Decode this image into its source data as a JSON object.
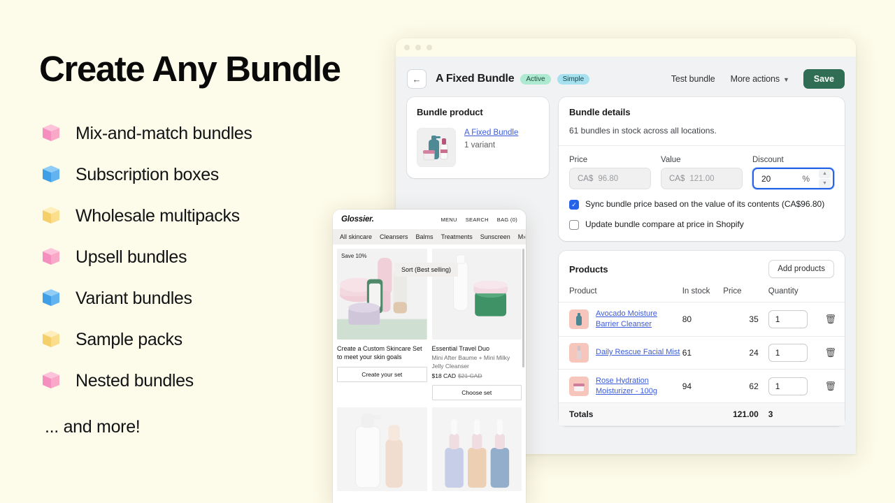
{
  "marketing": {
    "headline": "Create Any Bundle",
    "features": [
      {
        "label": "Mix-and-match bundles",
        "color": "pink"
      },
      {
        "label": "Subscription boxes",
        "color": "blue"
      },
      {
        "label": "Wholesale multipacks",
        "color": "yellow"
      },
      {
        "label": "Upsell bundles",
        "color": "pink"
      },
      {
        "label": "Variant bundles",
        "color": "blue"
      },
      {
        "label": "Sample packs",
        "color": "yellow"
      },
      {
        "label": "Nested bundles",
        "color": "pink"
      }
    ],
    "and_more": "... and more!"
  },
  "colors": {
    "page_background": "#fdfbe9",
    "admin_background": "#f1f2f4",
    "cube_pink": "#f9a8c8",
    "cube_blue": "#63b3f0",
    "cube_yellow": "#fade8e",
    "save_green": "#2f6d54",
    "badge_active": "#aee9d1",
    "badge_simple": "#a7e0ef",
    "focus_blue": "#2563eb",
    "link_blue": "#3b5bdb",
    "thumb_pink": "#f6c6bd"
  },
  "admin": {
    "topbar": {
      "back_icon": "arrow-left-icon",
      "title": "A Fixed Bundle",
      "badges": [
        {
          "label": "Active",
          "style": "active"
        },
        {
          "label": "Simple",
          "style": "simple"
        }
      ],
      "test_bundle_label": "Test bundle",
      "more_actions_label": "More actions",
      "more_actions_icon": "chevron-down-icon",
      "save_label": "Save"
    },
    "bundle_product": {
      "title": "Bundle product",
      "thumb_icon": "bundle-product-thumbnail",
      "product_link": "A Fixed Bundle",
      "variant_text": "1 variant"
    },
    "bundle_details": {
      "title": "Bundle details",
      "subtitle": "61 bundles in stock across all locations.",
      "price": {
        "label": "Price",
        "currency": "CA$",
        "value": "96.80"
      },
      "value": {
        "label": "Value",
        "currency": "CA$",
        "value": "121.00"
      },
      "discount": {
        "label": "Discount",
        "value": "20",
        "unit": "%",
        "stepper_up": "▲",
        "stepper_down": "▼"
      },
      "checkboxes": [
        {
          "label": "Sync bundle price based on the value of its contents (CA$96.80)",
          "checked": true
        },
        {
          "label": "Update bundle compare at price in Shopify",
          "checked": false
        }
      ]
    },
    "products": {
      "title": "Products",
      "add_button": "Add products",
      "columns": [
        "Product",
        "In stock",
        "Price",
        "Quantity"
      ],
      "rows": [
        {
          "name": "Avocado Moisture Barrier Cleanser",
          "in_stock": "80",
          "price": "35",
          "quantity": "1",
          "thumb": "cleanser-bottle-thumbnail",
          "delete_icon": "trash-icon"
        },
        {
          "name": "Daily Rescue Facial Mist",
          "in_stock": "61",
          "price": "24",
          "quantity": "1",
          "thumb": "mist-bottle-thumbnail",
          "delete_icon": "trash-icon"
        },
        {
          "name": "Rose Hydration Moisturizer - 100g",
          "in_stock": "94",
          "price": "62",
          "quantity": "1",
          "thumb": "moisturizer-jar-thumbnail",
          "delete_icon": "trash-icon"
        }
      ],
      "totals": {
        "label": "Totals",
        "price": "121.00",
        "quantity": "3"
      }
    }
  },
  "storefront": {
    "logo": "Glossier.",
    "nav_right": [
      "MENU",
      "SEARCH",
      "BAG (0)"
    ],
    "categories": [
      "All skincare",
      "Cleansers",
      "Balms",
      "Treatments",
      "Sunscreen"
    ],
    "categories_overflow": "M›ist",
    "sort_pill": "Sort  (Best selling)",
    "save_tag": "Save 10%",
    "tiles": [
      {
        "title": "Create a Custom Skincare Set to meet your skin goals",
        "desc": "",
        "price": "",
        "compare_at": "",
        "button": "Create your set"
      },
      {
        "title": "Essential Travel Duo",
        "desc": "Mini After Baume + Mini Milky Jelly Cleanser",
        "price": "$18 CAD",
        "compare_at": "$21 CAD",
        "button": "Choose set"
      }
    ]
  }
}
